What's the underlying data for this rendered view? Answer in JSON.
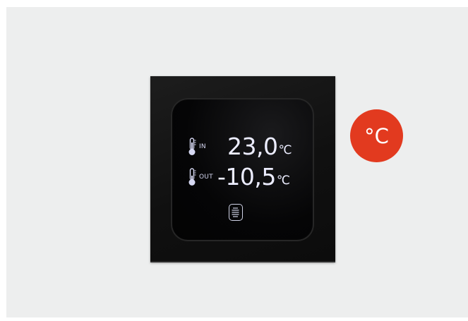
{
  "display": {
    "indoor": {
      "tag": "IN",
      "value": "23,0",
      "unit": "℃"
    },
    "outdoor": {
      "tag": "OUT",
      "value": "-10,5",
      "unit": "℃"
    },
    "menu_icon": "menu-lines-icon"
  },
  "badge": {
    "label": "°C",
    "color": "#e23a1f"
  },
  "colors": {
    "background": "#edeeee",
    "frame": "#141414",
    "display_text": "#e7e9ff"
  }
}
